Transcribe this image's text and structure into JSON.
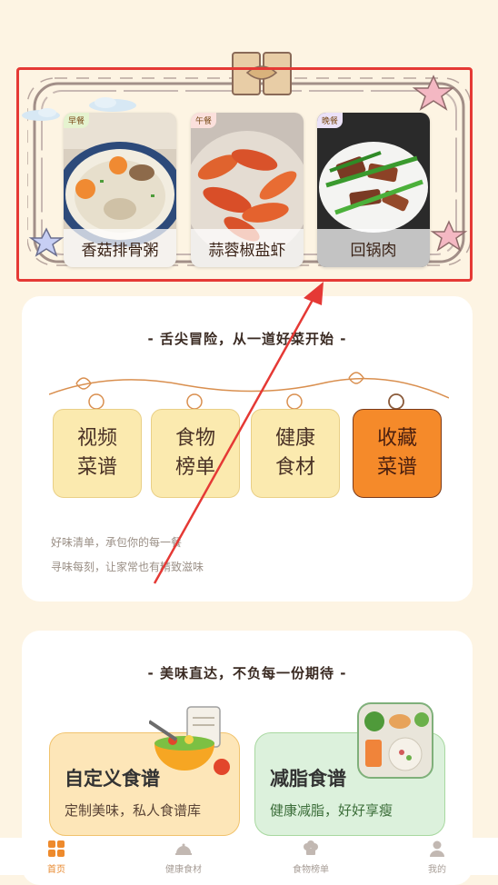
{
  "meals": [
    {
      "tag": "早餐",
      "name": "香菇排骨粥",
      "tag_color": "#e5f3cf"
    },
    {
      "tag": "午餐",
      "name": "蒜蓉椒盐虾",
      "tag_color": "#fbe0dc"
    },
    {
      "tag": "晚餐",
      "name": "回锅肉",
      "tag_color": "#ebe2f8"
    }
  ],
  "section1": {
    "title": "- 舌尖冒险，从一道好菜开始 -",
    "categories": [
      {
        "line1": "视频",
        "line2": "菜谱"
      },
      {
        "line1": "食物",
        "line2": "榜单"
      },
      {
        "line1": "健康",
        "line2": "食材"
      },
      {
        "line1": "收藏",
        "line2": "菜谱"
      }
    ],
    "desc1": "好味清单，承包你的每一餐",
    "desc2": "寻味每刻，让家常也有精致滋味"
  },
  "section2": {
    "title": "- 美味直达，不负每一份期待 -",
    "custom": {
      "title": "自定义食谱",
      "subtitle": "定制美味，私人食谱库"
    },
    "diet": {
      "title": "减脂食谱",
      "subtitle": "健康减脂，好好享瘦"
    }
  },
  "tabs": [
    {
      "label": "首页",
      "active": true
    },
    {
      "label": "健康食材",
      "active": false
    },
    {
      "label": "食物榜单",
      "active": false
    },
    {
      "label": "我的",
      "active": false
    }
  ],
  "colors": {
    "accent": "#e8892f",
    "annotation": "#e53935",
    "bg": "#fdf4e3"
  }
}
